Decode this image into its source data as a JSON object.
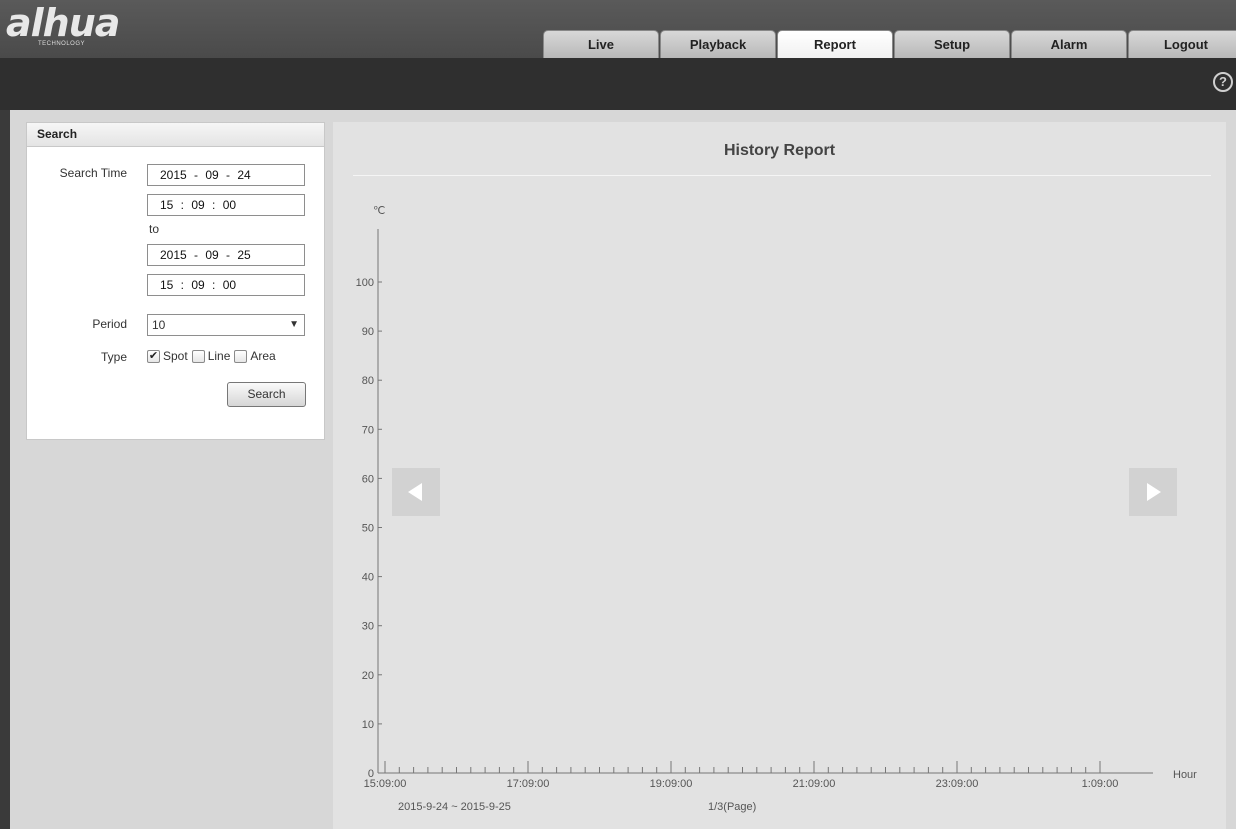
{
  "app": {
    "logo": "alhua",
    "logo_sub": "TECHNOLOGY"
  },
  "nav": {
    "tabs": [
      {
        "label": "Live",
        "active": false
      },
      {
        "label": "Playback",
        "active": false
      },
      {
        "label": "Report",
        "active": true
      },
      {
        "label": "Setup",
        "active": false
      },
      {
        "label": "Alarm",
        "active": false
      },
      {
        "label": "Logout",
        "active": false
      }
    ],
    "help_icon": "question-circle-icon"
  },
  "search": {
    "title": "Search",
    "search_time_label": "Search Time",
    "start_date": "2015 - 09 - 24",
    "start_time": "15 : 09 : 00",
    "to_label": "to",
    "end_date": "2015 - 09 - 25",
    "end_time": "15 : 09 : 00",
    "period_label": "Period",
    "period_value": "10",
    "type_label": "Type",
    "types": [
      {
        "label": "Spot",
        "checked": true
      },
      {
        "label": "Line",
        "checked": false
      },
      {
        "label": "Area",
        "checked": false
      }
    ],
    "search_button": "Search"
  },
  "report": {
    "title": "History Report",
    "date_range": "2015-9-24 ~ 2015-9-25",
    "page_info": "1/3(Page)",
    "prev_icon": "triangle-left-icon",
    "next_icon": "triangle-right-icon"
  },
  "chart_data": {
    "type": "line",
    "title": "History Report",
    "ylabel": "℃",
    "xlabel": "Hour",
    "ylim": [
      0,
      100
    ],
    "yticks": [
      0,
      10,
      20,
      30,
      40,
      50,
      60,
      70,
      80,
      90,
      100
    ],
    "xticks": [
      "15:09:00",
      "17:09:00",
      "19:09:00",
      "21:09:00",
      "23:09:00",
      "1:09:00"
    ],
    "series": []
  },
  "colors": {
    "header": "#4a4a4a",
    "subbar": "#2f2f2f",
    "workspace": "#d7d7d7",
    "report_bg": "#e2e2e2"
  }
}
